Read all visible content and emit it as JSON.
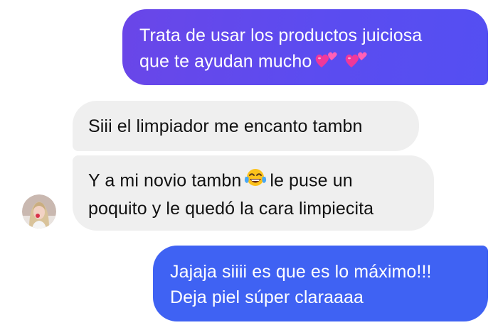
{
  "messages": {
    "outgoing_1": {
      "line1": "Trata de usar los productos juiciosa",
      "line2": "que te ayudan mucho"
    },
    "incoming_1": {
      "line1": "Siii el limpiador me encanto tambn"
    },
    "incoming_2": {
      "line1_a": "Y a mi novio tambn",
      "line1_b": "le puse un",
      "line2": "poquito y le quedó la cara limpiecita"
    },
    "outgoing_2": {
      "line1": "Jajaja siiii es que es lo máximo!!!",
      "line2": "Deja piel súper claraaaa"
    }
  },
  "icons": {
    "hearts": "two-hearts-emoji",
    "laugh": "tears-of-joy-emoji",
    "avatar": "contact-avatar"
  },
  "colors": {
    "outgoing_gradient_start": "#6a46e8",
    "outgoing_gradient_end": "#544ff2",
    "outgoing_blue": "#3f62f3",
    "incoming_bg": "#efefef",
    "text_dark": "#111111"
  }
}
